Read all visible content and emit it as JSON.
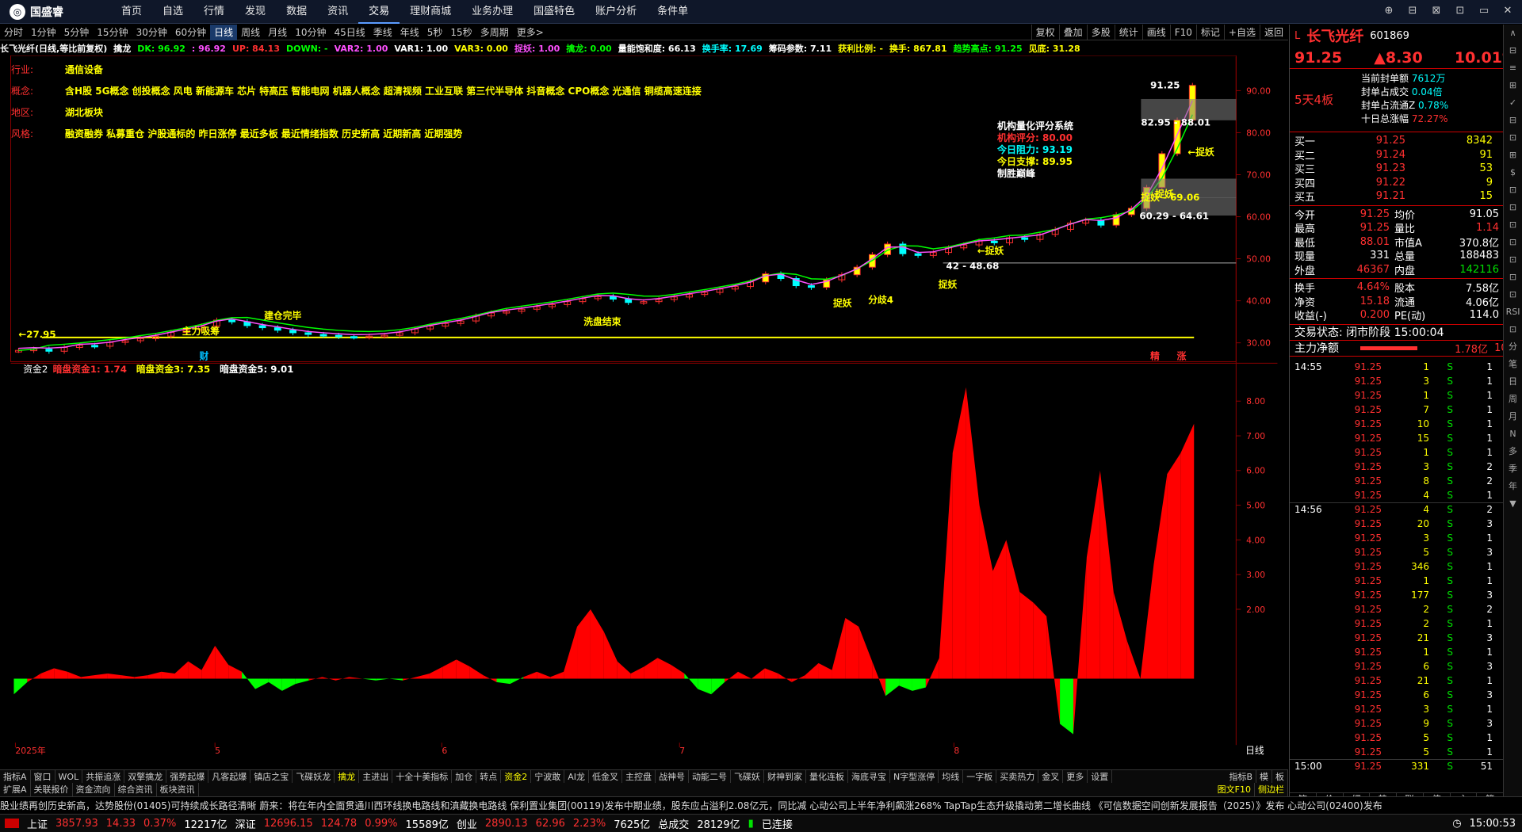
{
  "app": {
    "logo": "国盛睿",
    "menu": [
      "首页",
      "自选",
      "行情",
      "发现",
      "数据",
      "资讯",
      "交易",
      "理财商城",
      "业务办理",
      "国盛特色",
      "账户分析",
      "条件单"
    ],
    "active_menu": "交易"
  },
  "window_controls": [
    "⊕",
    "⊟",
    "⊠",
    "⊡",
    "▭",
    "✕"
  ],
  "periods": [
    "分时",
    "1分钟",
    "5分钟",
    "15分钟",
    "30分钟",
    "60分钟",
    "日线",
    "周线",
    "月线",
    "10分钟",
    "45日线",
    "季线",
    "年线",
    "5秒",
    "15秒",
    "多周期",
    "更多>"
  ],
  "active_period": "日线",
  "right_tools": [
    "复权",
    "叠加",
    "多股",
    "统计",
    "画线",
    "F10",
    "标记",
    "+自选",
    "返回"
  ],
  "infobar": [
    {
      "t": "长飞光纤(日线,等比前复权)",
      "c": "#ffffff"
    },
    {
      "t": "擒龙",
      "c": "#ffffff"
    },
    {
      "t": "DK: 96.92",
      "c": "#00ff00"
    },
    {
      "t": ": 96.92",
      "c": "#ff50ff"
    },
    {
      "t": "UP: 84.13",
      "c": "#ff3030"
    },
    {
      "t": "DOWN: -",
      "c": "#00ff00"
    },
    {
      "t": "VAR2: 1.00",
      "c": "#ff50ff"
    },
    {
      "t": "VAR1: 1.00",
      "c": "#ffffff"
    },
    {
      "t": "VAR3: 0.00",
      "c": "#ffff00"
    },
    {
      "t": "捉妖: 1.00",
      "c": "#ff50ff"
    },
    {
      "t": "擒龙: 0.00",
      "c": "#00ff00"
    },
    {
      "t": "量能饱和度: 66.13",
      "c": "#ffffff"
    },
    {
      "t": "换手率: 17.69",
      "c": "#00ffff"
    },
    {
      "t": "筹码参数: 7.11",
      "c": "#ffffff"
    },
    {
      "t": "获利比例: -",
      "c": "#ffff00"
    },
    {
      "t": "换手: 867.81",
      "c": "#ffff00"
    },
    {
      "t": "趋势高点: 91.25",
      "c": "#00ff00"
    },
    {
      "t": "见底: 31.28",
      "c": "#ffff00"
    }
  ],
  "tags": [
    {
      "k": "行业:",
      "v": "通信设备"
    },
    {
      "k": "概念:",
      "v": "含H股 5G概念 创投概念 风电 新能源车 芯片 特高压 智能电网 机器人概念 超清视频 工业互联 第三代半导体 抖音概念 CPO概念 光通信 铜缆高速连接"
    },
    {
      "k": "地区:",
      "v": "湖北板块"
    },
    {
      "k": "风格:",
      "v": "融资融券 私募重仓 沪股通标的 昨日涨停 最近多板 最近情绪指数 历史新高 近期新高 近期强势"
    }
  ],
  "score": {
    "title": "机构量化评分系统",
    "l1": "机构评分: 80.00",
    "l2": "今日阻力: 93.19",
    "l3": "今日支撑: 89.95",
    "l4": "制胜巅峰"
  },
  "chart_data": [
    {
      "type": "candlestick",
      "title": "长飞光纤(日线,等比前复权)",
      "y_ticks": [
        "90.00",
        "80.00",
        "70.00",
        "60.00",
        "50.00",
        "40.00",
        "30.00"
      ],
      "ylim": [
        27,
        98
      ],
      "x_ticks": [
        "2025年",
        "5",
        "6",
        "7",
        "8"
      ],
      "close_series": [
        28.2,
        28.5,
        28.0,
        28.9,
        29.4,
        29.2,
        30.1,
        30.5,
        31.0,
        31.6,
        32.5,
        33.1,
        34.0,
        35.4,
        35.0,
        34.1,
        33.6,
        33.0,
        32.4,
        32.0,
        31.8,
        31.5,
        31.4,
        31.6,
        31.8,
        32.4,
        33.3,
        34.0,
        34.6,
        35.2,
        36.4,
        37.1,
        37.5,
        38.0,
        38.6,
        39.1,
        39.8,
        40.5,
        41.0,
        40.4,
        39.6,
        39.8,
        40.3,
        40.9,
        41.5,
        42.0,
        42.8,
        43.4,
        44.5,
        46.4,
        45.3,
        43.6,
        43.2,
        45.0,
        46.2,
        48.0,
        51.0,
        53.5,
        51.2,
        50.8,
        51.5,
        52.6,
        53.3,
        54.2,
        53.8,
        55.0,
        54.6,
        55.8,
        57.0,
        58.5,
        59.2,
        58.0,
        60.5,
        62.0,
        67.0,
        75.0,
        83.0,
        91.25
      ],
      "annotations": [
        "←27.95",
        "主力吸筹",
        "建仓完毕",
        "洗盘结束",
        "捉妖",
        "分歧4",
        "捉妖",
        "42 - 48.68",
        "←捉妖",
        "60.29 - 64.61",
        "捉妖",
        "捉妖 - 69.06",
        "←捉妖",
        "82.95 - 88.01",
        "91.25",
        "财",
        "精",
        "涨"
      ]
    },
    {
      "type": "area",
      "title": "资金2",
      "legend": [
        "暗盘资金1: 1.74",
        "暗盘资金3: 7.35",
        "暗盘资金5: 9.01"
      ],
      "y_ticks": [
        "8.00",
        "7.00",
        "6.00",
        "5.00",
        "4.00",
        "3.00",
        "2.00"
      ],
      "ylim": [
        -1.8,
        8.8
      ],
      "values": [
        -0.45,
        -0.1,
        0.15,
        0.3,
        0.2,
        0.05,
        0.1,
        0.15,
        0.1,
        0.05,
        0.1,
        0.2,
        0.15,
        0.5,
        0.25,
        0.95,
        0.4,
        0.2,
        -0.3,
        -0.1,
        -0.35,
        -0.15,
        -0.05,
        0.05,
        -0.05,
        0.05,
        0.0,
        -0.05,
        0.0,
        -0.05,
        0.05,
        0.15,
        0.35,
        0.55,
        0.35,
        0.1,
        -0.1,
        -0.15,
        0.05,
        0.2,
        0.05,
        0.2,
        1.5,
        2.0,
        1.35,
        0.5,
        0.15,
        0.35,
        0.6,
        0.4,
        0.15,
        -0.3,
        -0.45,
        -0.1,
        0.2,
        0.0,
        0.3,
        0.15,
        -0.1,
        0.1,
        0.45,
        0.25,
        1.75,
        1.5,
        0.5,
        -0.5,
        -0.2,
        -0.35,
        -0.25,
        0.6,
        6.5,
        8.4,
        5.0,
        3.1,
        4.0,
        2.5,
        2.2,
        1.8,
        -1.3,
        -1.6,
        3.5,
        6.0,
        2.5,
        1.1,
        0.0,
        3.3,
        5.9,
        6.5,
        7.35
      ]
    }
  ],
  "quote": {
    "name": "长飞光纤",
    "code": "601869",
    "price": "91.25",
    "change": "▲8.30",
    "pct": "10.01%",
    "boards": "5天4板",
    "seal": [
      [
        "当前封单额",
        "7612万"
      ],
      [
        "封单占成交",
        "0.04倍"
      ],
      [
        "封单占流通Z",
        "0.78%"
      ],
      [
        "十日总涨幅",
        "72.27%"
      ]
    ],
    "book": [
      [
        "买一",
        "91.25",
        "8342"
      ],
      [
        "买二",
        "91.24",
        "91"
      ],
      [
        "买三",
        "91.23",
        "53"
      ],
      [
        "买四",
        "91.22",
        "9"
      ],
      [
        "买五",
        "91.21",
        "15"
      ]
    ],
    "stats": [
      [
        "今开",
        "91.25",
        "均价",
        "91.05"
      ],
      [
        "最高",
        "91.25",
        "量比",
        "1.14"
      ],
      [
        "最低",
        "88.01",
        "市值A",
        "370.8亿"
      ],
      [
        "现量",
        "331",
        "总量",
        "188483"
      ],
      [
        "外盘",
        "46367",
        "内盘",
        "142116"
      ]
    ],
    "stats2": [
      [
        "换手",
        "4.64%",
        "股本",
        "7.58亿"
      ],
      [
        "净资",
        "15.18",
        "流通",
        "4.06亿"
      ],
      [
        "收益(-)",
        "0.200",
        "PE(动)",
        "114.0"
      ]
    ],
    "phase": "交易状态: 闭市阶段 15:00:04",
    "netflow": "主力净额",
    "netflow_v": "1.78亿",
    "netflow_p": "10%"
  },
  "ticks": [
    [
      "14:55",
      "91.25",
      "1",
      "S",
      "1"
    ],
    [
      "",
      "91.25",
      "3",
      "S",
      "1"
    ],
    [
      "",
      "91.25",
      "1",
      "S",
      "1"
    ],
    [
      "",
      "91.25",
      "7",
      "S",
      "1"
    ],
    [
      "",
      "91.25",
      "10",
      "S",
      "1"
    ],
    [
      "",
      "91.25",
      "15",
      "S",
      "1"
    ],
    [
      "",
      "91.25",
      "1",
      "S",
      "1"
    ],
    [
      "",
      "91.25",
      "3",
      "S",
      "2"
    ],
    [
      "",
      "91.25",
      "8",
      "S",
      "2"
    ],
    [
      "",
      "91.25",
      "4",
      "S",
      "1"
    ],
    [
      "14:56",
      "91.25",
      "4",
      "S",
      "2"
    ],
    [
      "",
      "91.25",
      "20",
      "S",
      "3"
    ],
    [
      "",
      "91.25",
      "3",
      "S",
      "1"
    ],
    [
      "",
      "91.25",
      "5",
      "S",
      "3"
    ],
    [
      "",
      "91.25",
      "346",
      "S",
      "1"
    ],
    [
      "",
      "91.25",
      "1",
      "S",
      "1"
    ],
    [
      "",
      "91.25",
      "177",
      "S",
      "3"
    ],
    [
      "",
      "91.25",
      "2",
      "S",
      "2"
    ],
    [
      "",
      "91.25",
      "2",
      "S",
      "1"
    ],
    [
      "",
      "91.25",
      "21",
      "S",
      "3"
    ],
    [
      "",
      "91.25",
      "1",
      "S",
      "1"
    ],
    [
      "",
      "91.25",
      "6",
      "S",
      "3"
    ],
    [
      "",
      "91.25",
      "21",
      "S",
      "1"
    ],
    [
      "",
      "91.25",
      "6",
      "S",
      "3"
    ],
    [
      "",
      "91.25",
      "3",
      "S",
      "1"
    ],
    [
      "",
      "91.25",
      "9",
      "S",
      "3"
    ],
    [
      "",
      "91.25",
      "5",
      "S",
      "1"
    ],
    [
      "",
      "91.25",
      "5",
      "S",
      "1"
    ],
    [
      "15:00",
      "91.25",
      "331",
      "S",
      "51"
    ]
  ],
  "far_sidebar": [
    "∧",
    "⊟",
    "≡",
    "⊞",
    "✓",
    "⊟",
    "⊡",
    "⊞",
    "$",
    "⊡",
    "⊡",
    "⊡",
    "⊡",
    "⊡",
    "⊡",
    "⊡",
    "RSI",
    "⊡",
    "分",
    "笔",
    "日",
    "周",
    "月",
    "N",
    "多",
    "季",
    "年",
    "▼"
  ],
  "lowtabs": [
    "指标A",
    "窗口",
    "WOL",
    "共振追涨",
    "双擎擒龙",
    "强势起爆",
    "凡客起爆",
    "镇店之宝",
    "飞碟妖龙",
    "擒龙",
    "主进出",
    "十全十美指标",
    "加仓",
    "转点",
    "资金2",
    "宁波敢",
    "AI龙",
    "低金叉",
    "主控盘",
    "战神号",
    "动能二号",
    "飞碟妖",
    "财神到家",
    "量化连板",
    "海底寻宝",
    "N字型涨停",
    "均线",
    "一字板",
    "买卖热力",
    "金叉",
    "更多",
    "设置"
  ],
  "lowtabs_on": [
    "擒龙",
    "资金2"
  ],
  "lowtabs_right": [
    "指标B",
    "模",
    "板"
  ],
  "tabs2": [
    "扩展A",
    "关联报价",
    "资金流向",
    "综合资讯",
    "板块资讯"
  ],
  "tabs2_right": [
    "图文F10",
    "侧边栏"
  ],
  "rp_bottom_tabs": [
    "笔",
    "价",
    "细",
    "势",
    "联",
    "值",
    "主",
    "筹"
  ],
  "ticker": "股业绩再创历史新高，达势股份(01405)可持续成长路径清晰    蔚来：将在年内全面贯通川西环线换电路线和滇藏换电路线    保利置业集团(00119)发布中期业绩，股东应占溢利2.08亿元，同比减    心动公司上半年净利飙涨268% TapTap生态升级撬动第二增长曲线    《可信数据空间创新发展报告（2025）》发布    心动公司(02400)发布",
  "status": {
    "sh": "上证",
    "sh_v": "3857.93",
    "sh_c": "14.33",
    "sh_p": "0.37%",
    "sh_a": "12217亿",
    "sz": "深证",
    "sz_v": "12696.15",
    "sz_c": "124.78",
    "sz_p": "0.99%",
    "sz_a": "15589亿",
    "cy": "创业",
    "cy_v": "2890.13",
    "cy_c": "62.96",
    "cy_p": "2.23%",
    "cy_a": "7625亿",
    "tot": "总成交",
    "tot_v": "28129亿",
    "conn": "已连接",
    "time": "15:00:53"
  },
  "colors": {
    "up": "#ff3030",
    "down": "#00e000",
    "yellow": "#ffff00",
    "panel_bg": "#000000"
  }
}
